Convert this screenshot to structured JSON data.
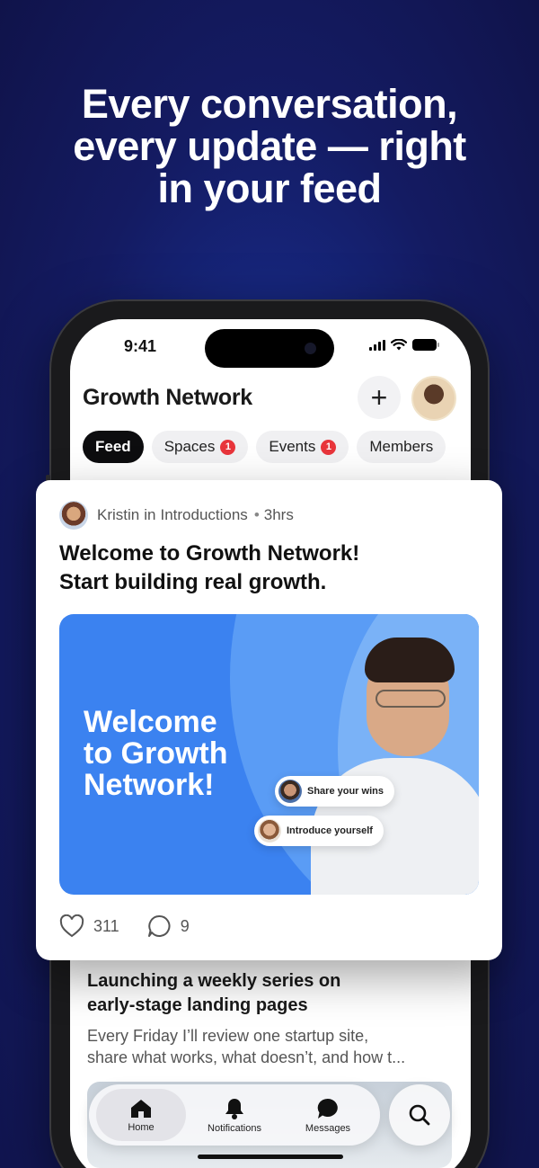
{
  "headline": {
    "line1": "Every conversation,",
    "line2": "every update — right",
    "line3": "in your feed"
  },
  "status": {
    "time": "9:41"
  },
  "app": {
    "title": "Growth Network"
  },
  "tabs": [
    {
      "label": "Feed",
      "active": true
    },
    {
      "label": "Spaces",
      "badge": "1"
    },
    {
      "label": "Events",
      "badge": "1"
    },
    {
      "label": "Members"
    }
  ],
  "post": {
    "author": "Kristin",
    "in_word": "in",
    "space": "Introductions",
    "time": "3hrs",
    "title_line1": "Welcome to Growth Network!",
    "title_line2": "Start building real growth.",
    "banner": {
      "line1": "Welcome",
      "line2": "to Growth",
      "line3": "Network!"
    },
    "chips": [
      "Share your wins",
      "Introduce yourself"
    ],
    "likes": "311",
    "comments": "9"
  },
  "post2": {
    "title_line1": "Launching a weekly series on",
    "title_line2": "early-stage landing pages",
    "body_line1": "Every Friday I’ll review one startup site,",
    "body_line2": "share what works, what doesn’t, and how t..."
  },
  "nav": [
    {
      "label": "Home",
      "icon": "home-icon",
      "active": true
    },
    {
      "label": "Notifications",
      "icon": "bell-icon"
    },
    {
      "label": "Messages",
      "icon": "chat-icon"
    }
  ],
  "colors": {
    "brand_blue": "#3b82f0",
    "badge_red": "#e8353b",
    "background": "#172a86"
  }
}
